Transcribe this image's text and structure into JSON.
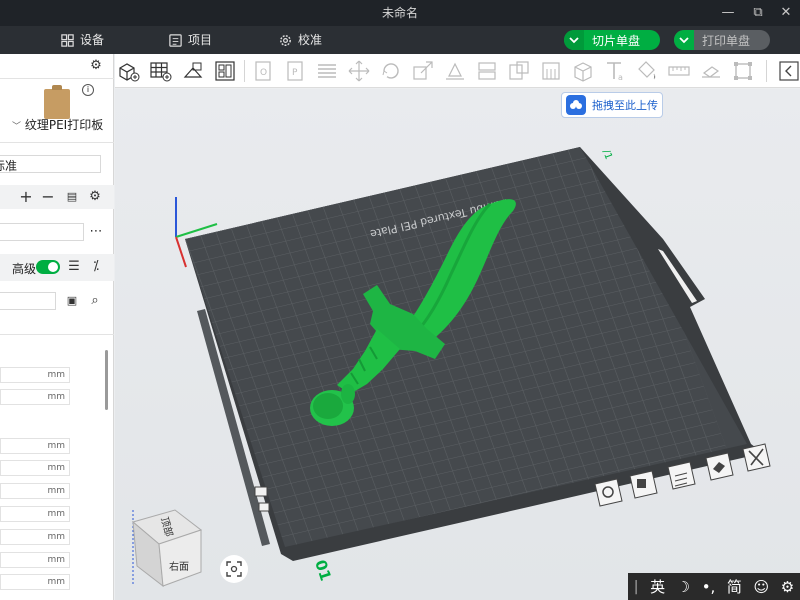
{
  "window": {
    "title": "未命名"
  },
  "menubar": {
    "device_label": "设备",
    "project_label": "项目",
    "calibrate_label": "校准",
    "slice_button_label": "切片单盘",
    "print_button_label": "打印单盘"
  },
  "left_panel": {
    "plate_type_label": "纹理PEI打印板",
    "profile_name": "标准",
    "advanced_label": "高级",
    "unit_mm": "mm"
  },
  "viewport": {
    "upload_label": "拖拽至此上传",
    "plate_title": "Bambu Textured PEI Plate",
    "plate_number": "01",
    "nav_cube_top": "顶部",
    "nav_cube_right": "右面"
  },
  "ime_bar": {
    "lang_label": "英",
    "simplified_label": "简"
  },
  "colors": {
    "brand_green": "#00ae42",
    "model_green": "#1fbf45",
    "titlebar_bg": "#1f2328",
    "menubar_bg": "#2b2f34",
    "plate_dark": "#3e4246"
  }
}
